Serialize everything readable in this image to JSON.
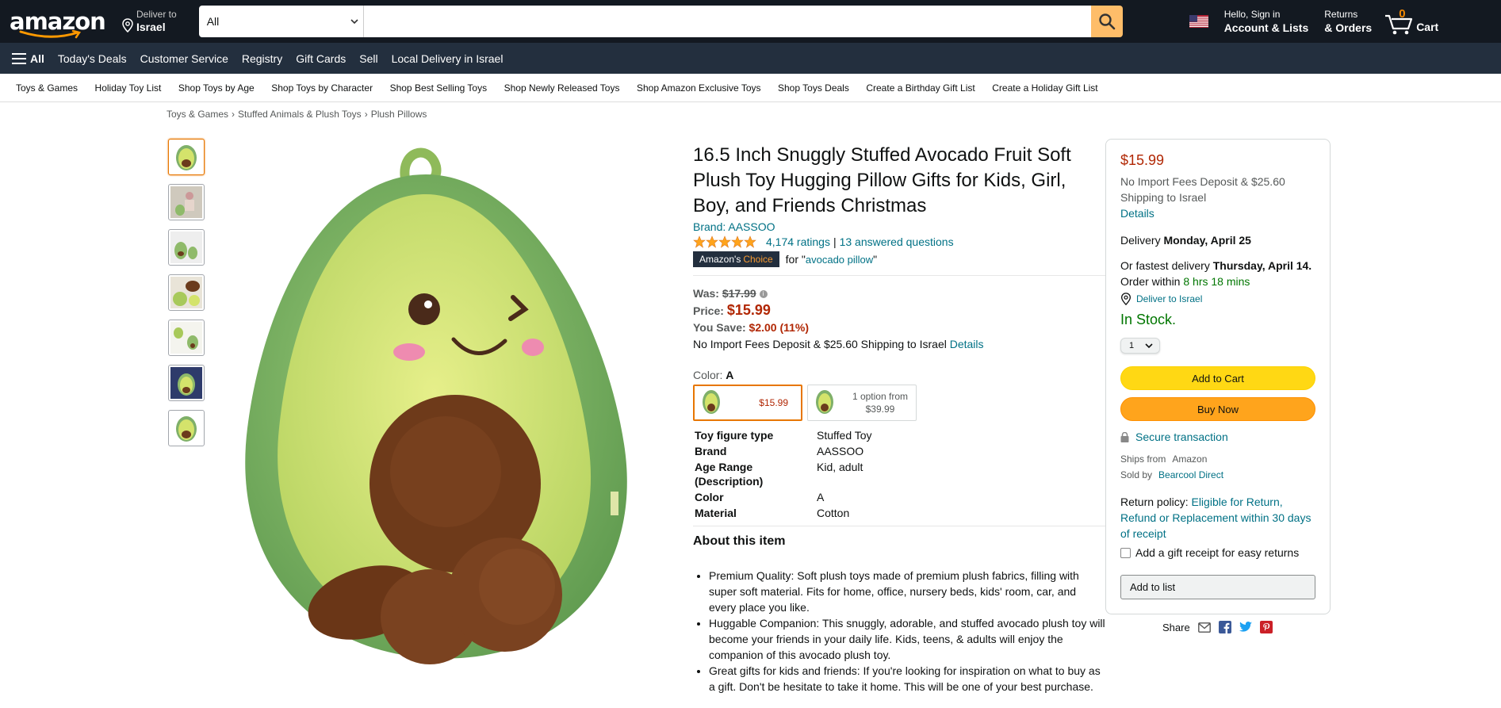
{
  "header": {
    "logo_text": "amazon",
    "deliver_line1": "Deliver to",
    "deliver_line2": "Israel",
    "search_category": "All",
    "search_placeholder": "",
    "account_line1": "Hello, Sign in",
    "account_line2": "Account & Lists",
    "orders_line1": "Returns",
    "orders_line2": "& Orders",
    "cart_count": "0",
    "cart_label": "Cart"
  },
  "main_nav": {
    "all_label": "All",
    "items": [
      "Today's Deals",
      "Customer Service",
      "Registry",
      "Gift Cards",
      "Sell",
      "Local Delivery in Israel"
    ]
  },
  "sub_nav": {
    "items": [
      "Toys & Games",
      "Holiday Toy List",
      "Shop Toys by Age",
      "Shop Toys by Character",
      "Shop Best Selling Toys",
      "Shop Newly Released Toys",
      "Shop Amazon Exclusive Toys",
      "Shop Toys Deals",
      "Create a Birthday Gift List",
      "Create a Holiday Gift List"
    ]
  },
  "breadcrumb": [
    "Toys & Games",
    "Stuffed Animals & Plush Toys",
    "Plush Pillows"
  ],
  "product": {
    "title": "16.5 Inch Snuggly Stuffed Avocado Fruit Soft Plush Toy Hugging Pillow Gifts for Kids, Girl, Boy, and Friends Christmas",
    "brand": "Brand: AASSOO",
    "ratings": "4,174 ratings",
    "rating_sep": "|",
    "questions": "13 answered questions",
    "choice_amazon": "Amazon's",
    "choice_word": "Choice",
    "choice_for": "for \"",
    "choice_query": "avocado pillow",
    "choice_end": "\"",
    "was_label": "Was:",
    "was_price": "$17.99",
    "price_label": "Price:",
    "price": "$15.99",
    "save_label": "You Save:",
    "save_value": "$2.00 (11%)",
    "import_note": "No Import Fees Deposit & $25.60 Shipping to Israel",
    "details_link": "Details",
    "color_label": "Color:",
    "color_value": "A",
    "swatches": [
      {
        "price": "$15.99"
      },
      {
        "line1": "1 option from",
        "line2": "$39.99"
      }
    ],
    "specs": [
      {
        "k": "Toy figure type",
        "v": "Stuffed Toy"
      },
      {
        "k": "Brand",
        "v": "AASSOO"
      },
      {
        "k": "Age Range (Description)",
        "v": "Kid, adult"
      },
      {
        "k": "Color",
        "v": "A"
      },
      {
        "k": "Material",
        "v": "Cotton"
      }
    ],
    "about_heading": "About this item",
    "bullets": [
      "Premium Quality: Soft plush toys made of premium plush fabrics, filling with super soft material. Fits for home, office, nursery beds, kids' room, car, and every place you like.",
      "Huggable Companion: This snuggly, adorable, and stuffed avocado plush toy will become your friends in your daily life. Kids, teens, & adults will enjoy the companion of this avocado plush toy.",
      "Great gifts for kids and friends: If you're looking for inspiration on what to buy as a gift. Don't be hesitate to take it home. This will be one of your best purchase."
    ]
  },
  "buybox": {
    "price": "$15.99",
    "import_note": "No Import Fees Deposit & $25.60 Shipping to Israel",
    "details_link": "Details",
    "delivery_prefix": "Delivery",
    "delivery_date": "Monday, April 25",
    "fast_prefix": "Or fastest delivery",
    "fast_date": "Thursday, April 14.",
    "order_within": "Order within",
    "order_time": "8 hrs 18 mins",
    "deliver_to": "Deliver to Israel",
    "stock": "In Stock.",
    "qty": "1",
    "add_to_cart": "Add to Cart",
    "buy_now": "Buy Now",
    "secure": "Secure transaction",
    "ships_from_label": "Ships from",
    "ships_from_value": "Amazon",
    "sold_by_label": "Sold by",
    "sold_by_value": "Bearcool Direct",
    "return_label": "Return policy:",
    "return_link": "Eligible for Return, Refund or Replacement within 30 days of receipt",
    "gift_receipt": "Add a gift receipt for easy returns",
    "add_to_list": "Add to list"
  },
  "share": {
    "label": "Share"
  },
  "colors": {
    "nav_top": "#131921",
    "nav_main": "#232f3e",
    "price_red": "#B12704",
    "link_teal": "#007185",
    "stock_green": "#007600",
    "cart_yellow": "#ffd814",
    "buy_orange": "#ffa41c"
  }
}
